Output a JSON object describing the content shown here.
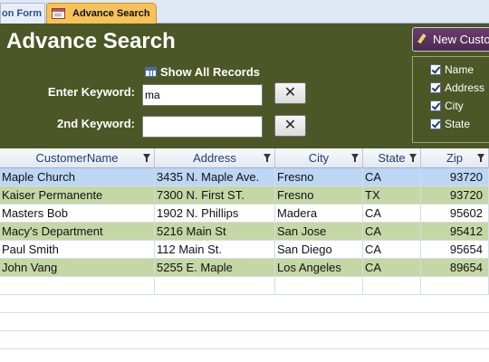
{
  "tabs": [
    {
      "label": "on Form"
    },
    {
      "label": "Advance Search"
    }
  ],
  "header": {
    "title": "Advance Search",
    "show_all_label": "Show All Records",
    "keyword_label": "Enter Keyword:",
    "keyword_value": "ma",
    "keyword2_label": "2nd Keyword:",
    "keyword2_value": "",
    "clear_glyph": "✕",
    "new_customer_label": "New Custo"
  },
  "filters": [
    {
      "label": "Name",
      "checked": true
    },
    {
      "label": "Address",
      "checked": true
    },
    {
      "label": "City",
      "checked": true
    },
    {
      "label": "State",
      "checked": true
    }
  ],
  "table": {
    "columns": [
      "CustomerName",
      "Address",
      "City",
      "State",
      "Zip"
    ],
    "rows": [
      [
        "Maple Church",
        "3435 N. Maple Ave.",
        "Fresno",
        "CA",
        "93720"
      ],
      [
        "Kaiser Permanente",
        "7300 N. First ST.",
        "Fresno",
        "TX",
        "93720"
      ],
      [
        "Masters Bob",
        "1902 N. Phillips",
        "Madera",
        "CA",
        "95602"
      ],
      [
        "Macy's Department",
        "5216 Main St",
        "San Jose",
        "CA",
        "95412"
      ],
      [
        "Paul Smith",
        "112 Main St.",
        "San Diego",
        "CA",
        "95654"
      ],
      [
        "John Vang",
        "5255 E. Maple",
        "Los Angeles",
        "CA",
        "89654"
      ]
    ]
  },
  "colors": {
    "header_bg": "#4b5726",
    "active_tab": "#f7c25a",
    "selected_row": "#bcd6f5",
    "alt_row": "#c5d7a5"
  }
}
